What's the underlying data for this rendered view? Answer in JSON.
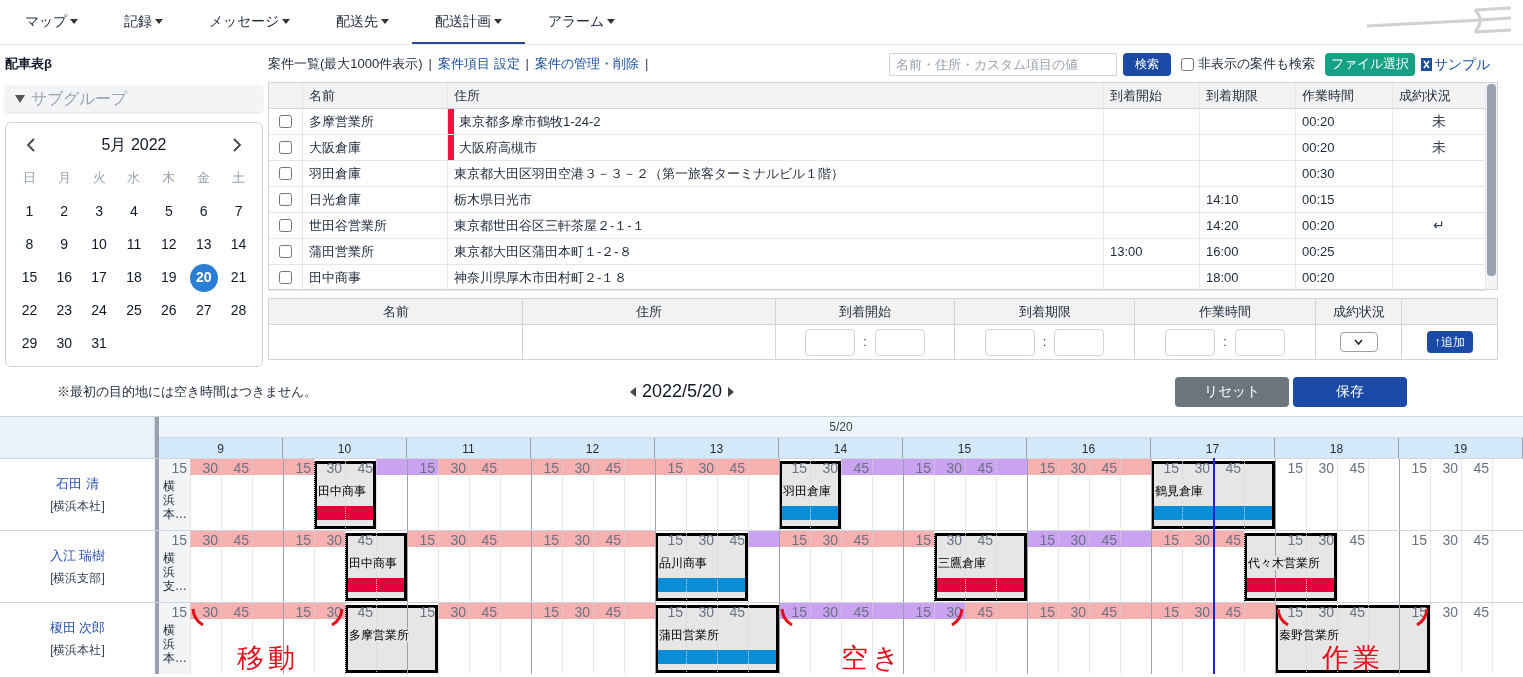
{
  "nav": {
    "items": [
      {
        "label": "マップ",
        "selected": false
      },
      {
        "label": "記録",
        "selected": false
      },
      {
        "label": "メッセージ",
        "selected": false
      },
      {
        "label": "配送先",
        "selected": false
      },
      {
        "label": "配送計画",
        "selected": true
      },
      {
        "label": "アラーム",
        "selected": false
      }
    ]
  },
  "page_title": "配車表β",
  "toolbar": {
    "items": [
      {
        "kind": "text",
        "text": "案件一覧(最大1000件表示)"
      },
      {
        "kind": "separator",
        "text": "|"
      },
      {
        "kind": "link",
        "text": "案件項目 設定"
      },
      {
        "kind": "separator",
        "text": "|"
      },
      {
        "kind": "link",
        "text": "案件の管理・削除"
      },
      {
        "kind": "separator",
        "text": "|"
      }
    ],
    "search": {
      "placeholder": "名前・住所・カスタム項目の値"
    },
    "search_button": "検索",
    "hidden_checkbox": {
      "label": "非表示の案件も検索",
      "checked": false
    },
    "file_button": "ファイル選択",
    "sample_link": "サンプル"
  },
  "subgroup": {
    "label": "サブグループ"
  },
  "calendar": {
    "title": "5月 2022",
    "weekdays": [
      "日",
      "月",
      "火",
      "水",
      "木",
      "金",
      "土"
    ],
    "days": [
      {
        "label": "1",
        "selected": false
      },
      {
        "label": "2",
        "selected": false
      },
      {
        "label": "3",
        "selected": false
      },
      {
        "label": "4",
        "selected": false
      },
      {
        "label": "5",
        "selected": false
      },
      {
        "label": "6",
        "selected": false
      },
      {
        "label": "7",
        "selected": false
      },
      {
        "label": "8",
        "selected": false
      },
      {
        "label": "9",
        "selected": false
      },
      {
        "label": "10",
        "selected": false
      },
      {
        "label": "11",
        "selected": false
      },
      {
        "label": "12",
        "selected": false
      },
      {
        "label": "13",
        "selected": false
      },
      {
        "label": "14",
        "selected": false
      },
      {
        "label": "15",
        "selected": false
      },
      {
        "label": "16",
        "selected": false
      },
      {
        "label": "17",
        "selected": false
      },
      {
        "label": "18",
        "selected": false
      },
      {
        "label": "19",
        "selected": false
      },
      {
        "label": "20",
        "selected": true
      },
      {
        "label": "21",
        "selected": false
      },
      {
        "label": "22",
        "selected": false
      },
      {
        "label": "23",
        "selected": false
      },
      {
        "label": "24",
        "selected": false
      },
      {
        "label": "25",
        "selected": false
      },
      {
        "label": "26",
        "selected": false
      },
      {
        "label": "27",
        "selected": false
      },
      {
        "label": "28",
        "selected": false
      },
      {
        "label": "29",
        "selected": false
      },
      {
        "label": "30",
        "selected": false
      },
      {
        "label": "31",
        "selected": false
      }
    ]
  },
  "case_table": {
    "columns": [
      "名前",
      "住所",
      "到着開始",
      "到着期限",
      "作業時間",
      "成約状況"
    ],
    "rows": [
      {
        "checked": false,
        "color": "#e8173f",
        "name": "多摩営業所",
        "address": "東京都多摩市鶴牧1-24-2",
        "work_time": "00:20",
        "status": "未"
      },
      {
        "checked": false,
        "color": "#e8173f",
        "name": "大阪倉庫",
        "address": "大阪府高槻市",
        "work_time": "00:20",
        "status": "未"
      },
      {
        "checked": false,
        "name": "羽田倉庫",
        "address": "東京都大田区羽田空港３－３－２（第一旅客ターミナルビル１階）",
        "work_time": "00:30"
      },
      {
        "checked": false,
        "name": "日光倉庫",
        "address": "栃木県日光市",
        "arrival_deadline": "14:10",
        "work_time": "00:15"
      },
      {
        "checked": false,
        "name": "世田谷営業所",
        "address": "東京都世田谷区三軒茶屋２-１-１",
        "arrival_deadline": "14:20",
        "work_time": "00:20",
        "status": "↵"
      },
      {
        "checked": false,
        "name": "蒲田営業所",
        "address": "東京都大田区蒲田本町１-２-８",
        "arrival_start": "13:00",
        "arrival_deadline": "16:00",
        "work_time": "00:25"
      },
      {
        "checked": false,
        "name": "田中商事",
        "address": "神奈川県厚木市田村町２-１８",
        "arrival_deadline": "18:00",
        "work_time": "00:20"
      }
    ]
  },
  "new_case_form": {
    "columns": [
      {
        "label": "名前",
        "kind": "blank"
      },
      {
        "label": "住所",
        "kind": "blank"
      },
      {
        "label": "到着開始",
        "kind": "time",
        "separator": ":"
      },
      {
        "label": "到着期限",
        "kind": "time",
        "separator": ":"
      },
      {
        "label": "作業時間",
        "kind": "time",
        "separator": ":"
      },
      {
        "label": "成約状況",
        "kind": "select"
      }
    ],
    "add_button": "↑追加"
  },
  "note": "※最初の目的地には空き時間はつきません。",
  "date_nav": {
    "date": "2022/5/20"
  },
  "reset_button": "リセット",
  "save_button": "保存",
  "schedule": {
    "date": "5/20",
    "hours": [
      {
        "label": "9",
        "now": false
      },
      {
        "label": "10",
        "now": false
      },
      {
        "label": "11",
        "now": false
      },
      {
        "label": "12",
        "now": false
      },
      {
        "label": "13",
        "now": false
      },
      {
        "label": "14",
        "now": false
      },
      {
        "label": "15",
        "now": false
      },
      {
        "label": "16",
        "now": false
      },
      {
        "label": "17",
        "now": true
      },
      {
        "label": "18",
        "now": false
      },
      {
        "label": "19",
        "now": false
      }
    ],
    "drivers": [
      {
        "name": "石田 清",
        "branch": "[横浜本社]",
        "blocks": [
          {
            "kind": "origin",
            "text": "横浜本…",
            "slots": [
              {
                "kind": "mark",
                "text": "15"
              }
            ]
          },
          {
            "kind": "travel",
            "slots": [
              {
                "kind": "mark",
                "text": "30"
              },
              {
                "kind": "mark",
                "text": "45"
              },
              {
                "kind": "blank"
              },
              {
                "kind": "mark",
                "text": "15"
              }
            ]
          },
          {
            "kind": "job",
            "name": "田中商事",
            "color": "#e4003a",
            "slots": [
              {
                "kind": "mark",
                "text": "30"
              },
              {
                "kind": "mark",
                "text": "45"
              }
            ]
          },
          {
            "kind": "free",
            "slots": [
              {
                "kind": "blank"
              },
              {
                "kind": "mark",
                "text": "15"
              }
            ]
          },
          {
            "kind": "travel",
            "slots": [
              {
                "kind": "mark",
                "text": "30"
              },
              {
                "kind": "mark",
                "text": "45"
              },
              {
                "kind": "blank"
              },
              {
                "kind": "mark",
                "text": "15"
              },
              {
                "kind": "mark",
                "text": "30"
              },
              {
                "kind": "mark",
                "text": "45"
              },
              {
                "kind": "blank"
              },
              {
                "kind": "mark",
                "text": "15"
              },
              {
                "kind": "mark",
                "text": "30"
              },
              {
                "kind": "mark",
                "text": "45"
              },
              {
                "kind": "blank"
              }
            ]
          },
          {
            "kind": "job",
            "name": "羽田倉庫",
            "color": "#0a8fd6",
            "slots": [
              {
                "kind": "mark",
                "text": "15"
              },
              {
                "kind": "mark",
                "text": "30"
              }
            ]
          },
          {
            "kind": "free",
            "slots": [
              {
                "kind": "mark",
                "text": "45"
              },
              {
                "kind": "blank"
              },
              {
                "kind": "mark",
                "text": "15"
              },
              {
                "kind": "mark",
                "text": "30"
              },
              {
                "kind": "mark",
                "text": "45"
              },
              {
                "kind": "blank"
              }
            ]
          },
          {
            "kind": "travel",
            "slots": [
              {
                "kind": "mark",
                "text": "15"
              },
              {
                "kind": "mark",
                "text": "30"
              },
              {
                "kind": "mark",
                "text": "45"
              },
              {
                "kind": "blank"
              }
            ]
          },
          {
            "kind": "job",
            "name": "鶴見倉庫",
            "color": "#0a8fd6",
            "slots": [
              {
                "kind": "mark",
                "text": "15"
              },
              {
                "kind": "mark",
                "text": "30"
              },
              {
                "kind": "mark",
                "text": "45"
              },
              {
                "kind": "blank"
              }
            ]
          },
          {
            "kind": "idle",
            "slots": [
              {
                "kind": "mark",
                "text": "15"
              },
              {
                "kind": "mark",
                "text": "30"
              },
              {
                "kind": "mark",
                "text": "45"
              },
              {
                "kind": "blank"
              },
              {
                "kind": "mark",
                "text": "15"
              },
              {
                "kind": "mark",
                "text": "30"
              },
              {
                "kind": "mark",
                "text": "45"
              },
              {
                "kind": "blank"
              }
            ]
          }
        ]
      },
      {
        "name": "入江 瑞樹",
        "branch": "[横浜支部]",
        "blocks": [
          {
            "kind": "origin",
            "text": "横浜支…",
            "slots": [
              {
                "kind": "mark",
                "text": "15"
              }
            ]
          },
          {
            "kind": "travel",
            "slots": [
              {
                "kind": "mark",
                "text": "30"
              },
              {
                "kind": "mark",
                "text": "45"
              },
              {
                "kind": "blank"
              },
              {
                "kind": "mark",
                "text": "15"
              },
              {
                "kind": "mark",
                "text": "30"
              }
            ]
          },
          {
            "kind": "job",
            "name": "田中商事",
            "color": "#e4003a",
            "slots": [
              {
                "kind": "mark",
                "text": "45"
              },
              {
                "kind": "blank"
              }
            ]
          },
          {
            "kind": "travel",
            "slots": [
              {
                "kind": "mark",
                "text": "15"
              },
              {
                "kind": "mark",
                "text": "30"
              },
              {
                "kind": "mark",
                "text": "45"
              },
              {
                "kind": "blank"
              },
              {
                "kind": "mark",
                "text": "15"
              },
              {
                "kind": "mark",
                "text": "30"
              },
              {
                "kind": "mark",
                "text": "45"
              },
              {
                "kind": "blank"
              }
            ]
          },
          {
            "kind": "job",
            "name": "品川商事",
            "color": "#0a8fd6",
            "slots": [
              {
                "kind": "mark",
                "text": "15"
              },
              {
                "kind": "mark",
                "text": "30"
              },
              {
                "kind": "mark",
                "text": "45"
              }
            ]
          },
          {
            "kind": "free",
            "slots": [
              {
                "kind": "blank"
              }
            ]
          },
          {
            "kind": "travel",
            "slots": [
              {
                "kind": "mark",
                "text": "15"
              },
              {
                "kind": "mark",
                "text": "30"
              },
              {
                "kind": "mark",
                "text": "45"
              },
              {
                "kind": "blank"
              },
              {
                "kind": "mark",
                "text": "15"
              }
            ]
          },
          {
            "kind": "job",
            "name": "三鷹倉庫",
            "color": "#e4003a",
            "slots": [
              {
                "kind": "mark",
                "text": "30"
              },
              {
                "kind": "mark",
                "text": "45"
              },
              {
                "kind": "blank"
              }
            ]
          },
          {
            "kind": "free",
            "slots": [
              {
                "kind": "mark",
                "text": "15"
              },
              {
                "kind": "mark",
                "text": "30"
              },
              {
                "kind": "mark",
                "text": "45"
              },
              {
                "kind": "blank"
              }
            ]
          },
          {
            "kind": "travel",
            "slots": [
              {
                "kind": "mark",
                "text": "15"
              },
              {
                "kind": "mark",
                "text": "30"
              },
              {
                "kind": "mark",
                "text": "45"
              }
            ]
          },
          {
            "kind": "job",
            "name": "代々木営業所",
            "color": "#e4003a",
            "slots": [
              {
                "kind": "blank"
              },
              {
                "kind": "mark",
                "text": "15"
              },
              {
                "kind": "mark",
                "text": "30"
              }
            ]
          },
          {
            "kind": "idle",
            "slots": [
              {
                "kind": "mark",
                "text": "45"
              },
              {
                "kind": "blank"
              },
              {
                "kind": "mark",
                "text": "15"
              },
              {
                "kind": "mark",
                "text": "30"
              },
              {
                "kind": "mark",
                "text": "45"
              },
              {
                "kind": "blank"
              }
            ]
          }
        ]
      },
      {
        "name": "榎田 次郎",
        "branch": "[横浜本社]",
        "blocks": [
          {
            "kind": "origin",
            "text": "横浜本…",
            "slots": [
              {
                "kind": "mark",
                "text": "15"
              }
            ]
          },
          {
            "kind": "travel",
            "annotation": "移動",
            "slots": [
              {
                "kind": "mark",
                "text": "30"
              },
              {
                "kind": "mark",
                "text": "45"
              },
              {
                "kind": "blank"
              },
              {
                "kind": "mark",
                "text": "15"
              },
              {
                "kind": "mark",
                "text": "30"
              }
            ]
          },
          {
            "kind": "job",
            "name": "多摩営業所",
            "slots": [
              {
                "kind": "mark",
                "text": "45"
              },
              {
                "kind": "blank"
              },
              {
                "kind": "mark",
                "text": "15"
              }
            ]
          },
          {
            "kind": "travel",
            "slots": [
              {
                "kind": "mark",
                "text": "30"
              },
              {
                "kind": "mark",
                "text": "45"
              },
              {
                "kind": "blank"
              },
              {
                "kind": "mark",
                "text": "15"
              },
              {
                "kind": "mark",
                "text": "30"
              },
              {
                "kind": "mark",
                "text": "45"
              },
              {
                "kind": "blank"
              }
            ]
          },
          {
            "kind": "job",
            "name": "蒲田営業所",
            "color": "#0a8fd6",
            "slots": [
              {
                "kind": "mark",
                "text": "15"
              },
              {
                "kind": "mark",
                "text": "30"
              },
              {
                "kind": "mark",
                "text": "45"
              },
              {
                "kind": "blank"
              }
            ]
          },
          {
            "kind": "free",
            "annotation": "空き",
            "slots": [
              {
                "kind": "mark",
                "text": "15"
              },
              {
                "kind": "mark",
                "text": "30"
              },
              {
                "kind": "mark",
                "text": "45"
              },
              {
                "kind": "blank"
              },
              {
                "kind": "mark",
                "text": "15"
              },
              {
                "kind": "mark",
                "text": "30"
              }
            ]
          },
          {
            "kind": "travel",
            "slots": [
              {
                "kind": "mark",
                "text": "45"
              },
              {
                "kind": "blank"
              },
              {
                "kind": "mark",
                "text": "15"
              },
              {
                "kind": "mark",
                "text": "30"
              },
              {
                "kind": "mark",
                "text": "45"
              },
              {
                "kind": "blank"
              },
              {
                "kind": "mark",
                "text": "15"
              },
              {
                "kind": "mark",
                "text": "30"
              },
              {
                "kind": "mark",
                "text": "45"
              },
              {
                "kind": "blank"
              }
            ]
          },
          {
            "kind": "job",
            "name": "秦野営業所",
            "annotation": "作業",
            "slots": [
              {
                "kind": "mark",
                "text": "15"
              },
              {
                "kind": "mark",
                "text": "30"
              },
              {
                "kind": "mark",
                "text": "45"
              },
              {
                "kind": "blank"
              },
              {
                "kind": "mark",
                "text": "15"
              }
            ]
          },
          {
            "kind": "idle",
            "slots": [
              {
                "kind": "mark",
                "text": "30"
              },
              {
                "kind": "mark",
                "text": "45"
              },
              {
                "kind": "blank"
              }
            ]
          }
        ]
      }
    ]
  }
}
